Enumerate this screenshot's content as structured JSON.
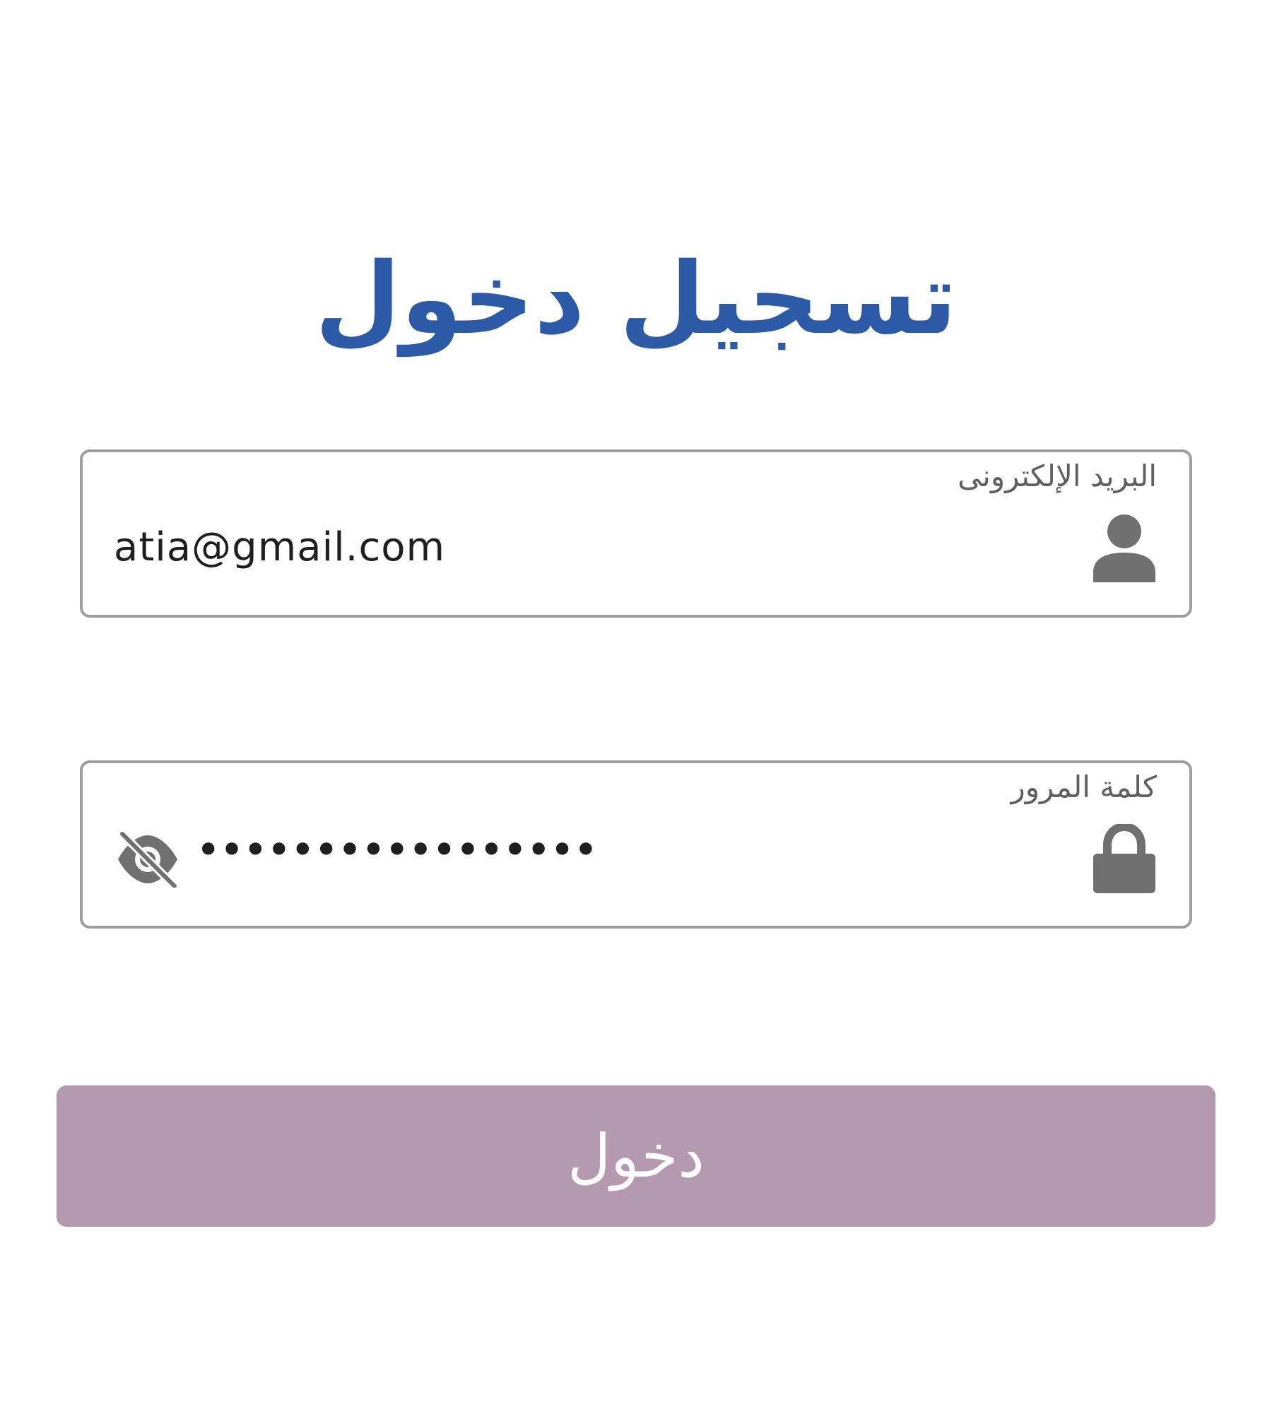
{
  "header": {
    "title": "تسجيل دخول"
  },
  "form": {
    "email": {
      "label": "البريد الإلكترونى",
      "value": "atia@gmail.com",
      "icon": "person-icon"
    },
    "password": {
      "label": "كلمة المرور",
      "value": "•••••••••••••••••",
      "icon": "lock-icon",
      "toggle_icon": "eye-off-icon"
    },
    "submit_label": "دخول"
  },
  "colors": {
    "title": "#2c5aa6",
    "button_bg": "#b599af",
    "button_text": "#ffffff",
    "border": "#9e9e9e",
    "icon": "#707070",
    "label": "#5f5f5f"
  }
}
